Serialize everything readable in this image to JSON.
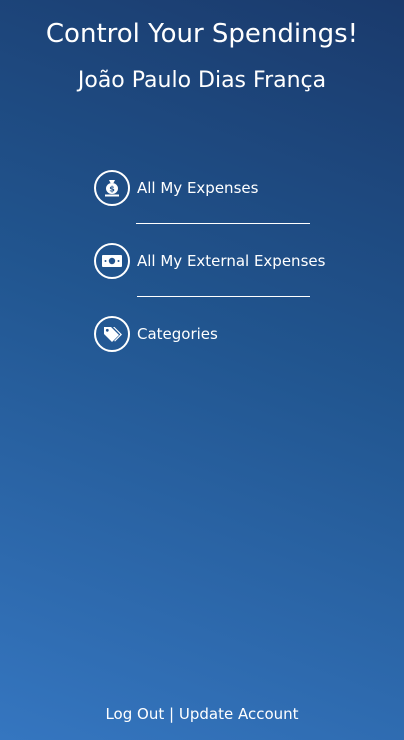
{
  "header": {
    "title": "Control Your Spendings!",
    "user_name": "João Paulo Dias França"
  },
  "menu": {
    "items": [
      {
        "label": "All My Expenses",
        "icon": "money-bag-icon"
      },
      {
        "label": "All My External Expenses",
        "icon": "banknote-icon"
      },
      {
        "label": "Categories",
        "icon": "tags-icon"
      }
    ]
  },
  "footer": {
    "logout_label": "Log Out",
    "separator": "|",
    "update_account_label": "Update Account"
  },
  "colors": {
    "text": "#ffffff",
    "gradient_dark": "#1a3a6c",
    "gradient_light": "#3576c0"
  }
}
